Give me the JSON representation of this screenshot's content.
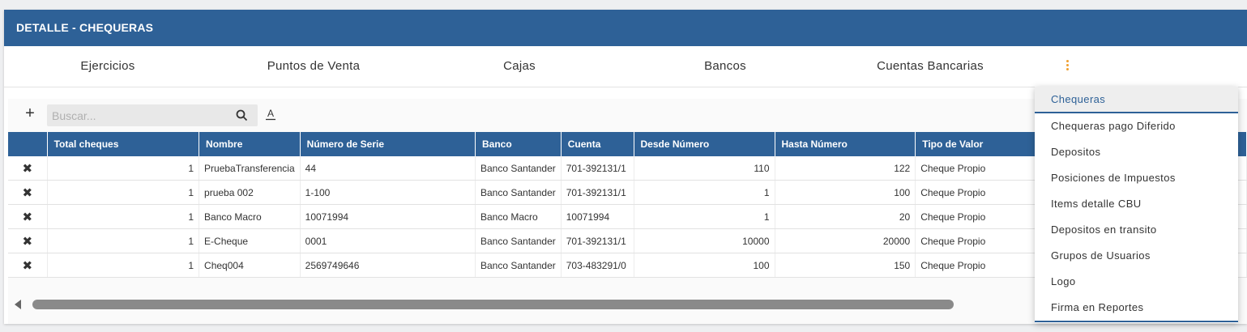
{
  "header": {
    "title": "DETALLE - CHEQUERAS"
  },
  "tabs": [
    {
      "label": "Ejercicios"
    },
    {
      "label": "Puntos de Venta"
    },
    {
      "label": "Cajas"
    },
    {
      "label": "Bancos"
    },
    {
      "label": "Cuentas Bancarias"
    }
  ],
  "colors": {
    "brand": "#2e6197",
    "kebab": "#f0a030"
  },
  "toolbar": {
    "add_label": "+",
    "search_placeholder": "Buscar...",
    "font_label": "A"
  },
  "table": {
    "columns": [
      "",
      "Total cheques",
      "Nombre",
      "Número de Serie",
      "Banco",
      "Cuenta",
      "Desde Número",
      "Hasta Número",
      "Tipo de Valor"
    ],
    "rows": [
      {
        "del": "✖",
        "total": "1",
        "nombre": "PruebaTransferencia",
        "serie": "44",
        "banco": "Banco Santander",
        "cuenta": "701-392131/1",
        "desde": "110",
        "hasta": "122",
        "tipo": "Cheque Propio"
      },
      {
        "del": "✖",
        "total": "1",
        "nombre": "prueba 002",
        "serie": "1-100",
        "banco": "Banco Santander",
        "cuenta": "701-392131/1",
        "desde": "1",
        "hasta": "100",
        "tipo": "Cheque Propio"
      },
      {
        "del": "✖",
        "total": "1",
        "nombre": "Banco Macro",
        "serie": "10071994",
        "banco": "Banco Macro",
        "cuenta": "10071994",
        "desde": "1",
        "hasta": "20",
        "tipo": "Cheque Propio"
      },
      {
        "del": "✖",
        "total": "1",
        "nombre": "E-Cheque",
        "serie": "0001",
        "banco": "Banco Santander",
        "cuenta": "701-392131/1",
        "desde": "10000",
        "hasta": "20000",
        "tipo": "Cheque Propio"
      },
      {
        "del": "✖",
        "total": "1",
        "nombre": "Cheq004",
        "serie": "2569749646",
        "banco": "Banco Santander",
        "cuenta": "703-483291/0",
        "desde": "100",
        "hasta": "150",
        "tipo": "Cheque Propio"
      }
    ]
  },
  "menu": {
    "items": [
      "Chequeras",
      "Chequeras pago Diferido",
      "Depositos",
      "Posiciones de Impuestos",
      "Items detalle CBU",
      "Depositos en transito",
      "Grupos de Usuarios",
      "Logo",
      "Firma en Reportes"
    ],
    "active_index": 0
  }
}
